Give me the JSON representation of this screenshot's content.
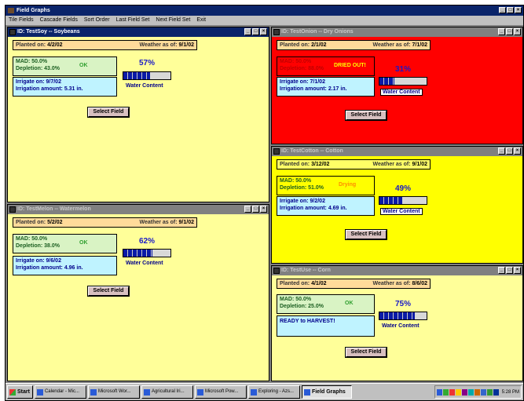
{
  "app": {
    "title": "Field Graphs",
    "icon": "field-graphs-icon"
  },
  "menu": [
    "Tile Fields",
    "Cascade Fields",
    "Sort Order",
    "Last Field Set",
    "Next Field Set",
    "Exit"
  ],
  "window_controls": {
    "min": "_",
    "max": "□",
    "close": "×"
  },
  "fields": [
    {
      "id": "soy",
      "title": "ID: TestSoy   -- Soybeans",
      "planted_label": "Planted on:",
      "planted": "4/2/02",
      "weather_label": "Weather as of:",
      "weather": "9/1/02",
      "mad": "MAD: 50.0%",
      "depletion": "Depletion: 43.0%",
      "status": "OK",
      "irrigate_on": "Irrigate on:  9/7/02",
      "irrigation_amount": "Irrigation amount:  5.31 in.",
      "water_pct": "57%",
      "water_content": 0.57,
      "water_label": "Water Content",
      "select": "Select Field",
      "bg": "#ffff99"
    },
    {
      "id": "onion",
      "title": "ID: TestOnion   -- Dry Onions",
      "planted_label": "Planted on:",
      "planted": "2/1/02",
      "weather_label": "Weather as of:",
      "weather": "7/1/02",
      "mad": "MAD: 50.0%",
      "depletion": "Depletion: 88.0%",
      "status": "DRIED OUT!",
      "irrigate_on": "Irrigate on:  7/1/02",
      "irrigation_amount": "Irrigation amount:  2.17 in.",
      "water_pct": "31%",
      "water_content": 0.31,
      "water_label": "Water Content",
      "select": "Select Field",
      "bg": "#ff0000"
    },
    {
      "id": "melon",
      "title": "ID: TestMelon   -- Watermelon",
      "planted_label": "Planted on:",
      "planted": "5/2/02",
      "weather_label": "Weather as of:",
      "weather": "9/1/02",
      "mad": "MAD: 50.0%",
      "depletion": "Depletion: 38.0%",
      "status": "OK",
      "irrigate_on": "Irrigate on:  9/6/02",
      "irrigation_amount": "Irrigation amount:  4.96 in.",
      "water_pct": "62%",
      "water_content": 0.62,
      "water_label": "Water Content",
      "select": "Select Field",
      "bg": "#ffff99"
    },
    {
      "id": "cotton",
      "title": "ID: TestCotton   -- Cotton",
      "planted_label": "Planted on:",
      "planted": "3/12/02",
      "weather_label": "Weather as of:",
      "weather": "9/1/02",
      "mad": "MAD: 50.0%",
      "depletion": "Depletion: 51.0%",
      "status": "Drying",
      "irrigate_on": "Irrigate on:  9/2/02",
      "irrigation_amount": "Irrigation amount:  4.69 in.",
      "water_pct": "49%",
      "water_content": 0.49,
      "water_label": "Water Content",
      "select": "Select Field",
      "bg": "#ffff00"
    },
    {
      "id": "corn",
      "title": "ID: TestUse   -- Corn",
      "planted_label": "Planted on:",
      "planted": "4/1/02",
      "weather_label": "Weather as of:",
      "weather": "8/6/02",
      "mad": "MAD: 50.0%",
      "depletion": "Depletion: 25.0%",
      "status": "OK",
      "ready": "READY to HARVEST!",
      "water_pct": "75%",
      "water_content": 0.75,
      "water_label": "Water Content",
      "select": "Select Field",
      "bg": "#ffff99"
    }
  ],
  "taskbar": {
    "start": "Start",
    "items": [
      "Calendar - Mic...",
      "Microsoft Wor...",
      "Agricultural Iri...",
      "Microsoft Pow...",
      "Exploring - Azs...",
      "Field Graphs"
    ],
    "clock": "5:28 PM"
  }
}
